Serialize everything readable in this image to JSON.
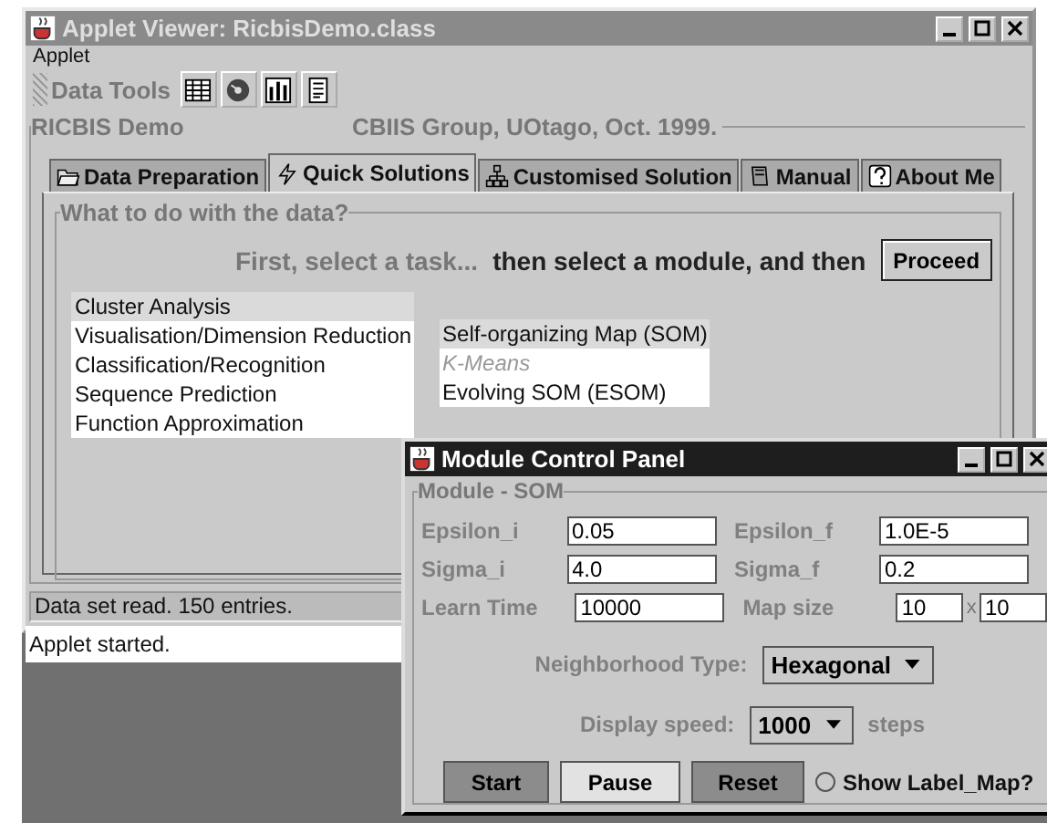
{
  "main_window": {
    "title": "Applet Viewer: RicbisDemo.class",
    "menu": [
      "Applet"
    ],
    "toolbar": {
      "label": "Data Tools"
    },
    "group": {
      "title": "RICBIS Demo",
      "credit": "CBIIS Group, UOtago, Oct. 1999."
    },
    "tabs": [
      {
        "label": "Data Preparation",
        "selected": false
      },
      {
        "label": "Quick Solutions",
        "selected": true
      },
      {
        "label": "Customised Solution",
        "selected": false
      },
      {
        "label": "Manual",
        "selected": false
      },
      {
        "label": "About Me",
        "selected": false
      }
    ],
    "panel": {
      "title": "What to do with the data?",
      "instructions": [
        {
          "text": "First, select a task...",
          "dimmed": true
        },
        {
          "text": "then select a module, and then",
          "dimmed": false
        }
      ],
      "proceed_button": "Proceed",
      "tasks": [
        {
          "label": "Cluster Analysis",
          "selected": true
        },
        {
          "label": "Visualisation/Dimension Reduction",
          "selected": false
        },
        {
          "label": "Classification/Recognition",
          "selected": false
        },
        {
          "label": "Sequence Prediction",
          "selected": false
        },
        {
          "label": "Function Approximation",
          "selected": false
        }
      ],
      "modules": [
        {
          "label": "Self-organizing Map (SOM)",
          "selected": true,
          "disabled": false
        },
        {
          "label": "K-Means",
          "selected": false,
          "disabled": true
        },
        {
          "label": "Evolving SOM (ESOM)",
          "selected": false,
          "disabled": false
        }
      ]
    },
    "status_bar": "Data set read. 150 entries.",
    "applet_status": "Applet started."
  },
  "control_panel": {
    "title": "Module Control Panel",
    "group": "Module - SOM",
    "fields": [
      [
        {
          "label": "Epsilon_i",
          "value": "0.05"
        },
        {
          "label": "Epsilon_f",
          "value": "1.0E-5"
        }
      ],
      [
        {
          "label": "Sigma_i",
          "value": "4.0"
        },
        {
          "label": "Sigma_f",
          "value": "0.2"
        }
      ],
      [
        {
          "label": "Learn Time",
          "value": "10000"
        },
        {
          "label": "Map size",
          "value": "10",
          "separator": "x",
          "value2": "10"
        }
      ]
    ],
    "neighborhood": {
      "label": "Neighborhood Type:",
      "value": "Hexagonal"
    },
    "speed": {
      "label": "Display speed:",
      "value": "1000",
      "unit": "steps"
    },
    "buttons": [
      {
        "label": "Start",
        "shaded": true
      },
      {
        "label": "Pause",
        "shaded": false
      },
      {
        "label": "Reset",
        "shaded": true
      }
    ],
    "show_label_map": {
      "label": "Show Label_Map?",
      "checked": false
    }
  }
}
